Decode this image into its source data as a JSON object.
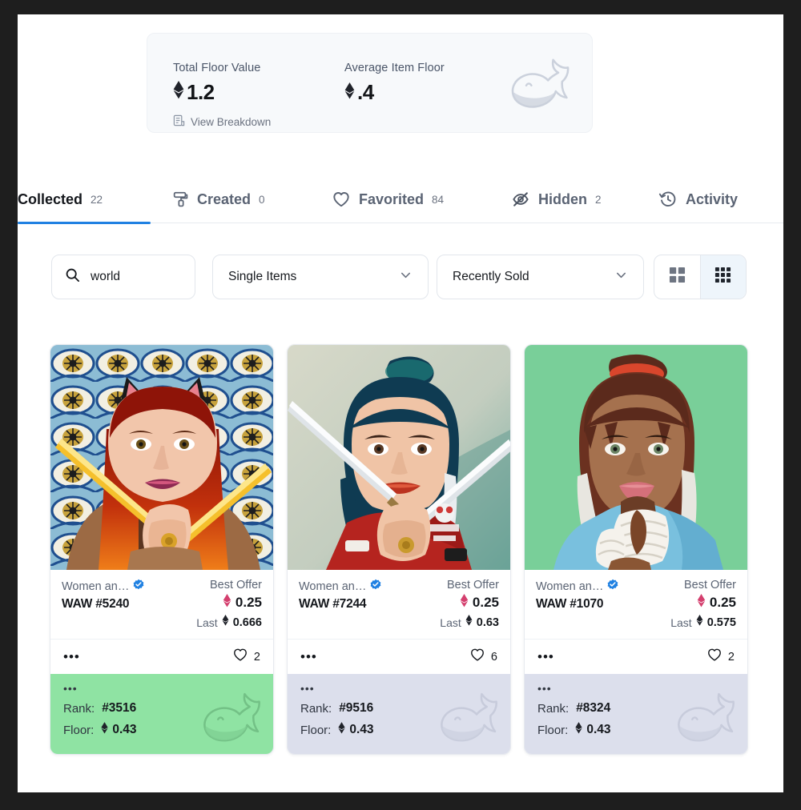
{
  "stats": {
    "total_floor_label": "Total Floor Value",
    "total_floor_value": "1.2",
    "avg_floor_label": "Average Item Floor",
    "avg_floor_value": ".4",
    "breakdown_link": "View Breakdown",
    "eth_symbol": "♦",
    "card_bg": "#f7f9fb"
  },
  "tabs": [
    {
      "label": "Collected",
      "count": "22",
      "icon": "none",
      "active": true
    },
    {
      "label": "Created",
      "count": "0",
      "icon": "paint-roller-icon",
      "active": false
    },
    {
      "label": "Favorited",
      "count": "84",
      "icon": "heart-icon",
      "active": false
    },
    {
      "label": "Hidden",
      "count": "2",
      "icon": "eye-off-icon",
      "active": false
    },
    {
      "label": "Activity",
      "count": "",
      "icon": "history-icon",
      "active": false
    }
  ],
  "accent_color": "#2081e2",
  "filters": {
    "search_value": "world",
    "search_placeholder": "Search",
    "dropdown_items": "Single Items",
    "dropdown_sort": "Recently Sold",
    "view_grid_large": "grid-2x2-icon",
    "view_grid_small": "grid-3x3-icon",
    "active_view": "grid-3x3-icon"
  },
  "cards": [
    {
      "collection": "Women an…",
      "verified": true,
      "name": "WAW #5240",
      "offer_label": "Best Offer",
      "offer_price": "0.25",
      "last_label": "Last",
      "last_price": "0.666",
      "likes": "2",
      "menu": "•••",
      "rank_label": "Rank:",
      "rank_value": "#3516",
      "floor_label": "Floor:",
      "floor_value": "0.43",
      "footer_color": "#8fe3a3",
      "art": "woman-red-hair-cat-ears-gold-swords"
    },
    {
      "collection": "Women an…",
      "verified": true,
      "name": "WAW #7244",
      "offer_label": "Best Offer",
      "offer_price": "0.25",
      "last_label": "Last",
      "last_price": "0.63",
      "likes": "6",
      "menu": "•••",
      "rank_label": "Rank:",
      "rank_value": "#9516",
      "floor_label": "Floor:",
      "floor_value": "0.43",
      "footer_color": "#dcdfec",
      "art": "woman-blue-hair-red-shirt-silver-blades"
    },
    {
      "collection": "Women an…",
      "verified": true,
      "name": "WAW #1070",
      "offer_label": "Best Offer",
      "offer_price": "0.25",
      "last_label": "Last",
      "last_price": "0.575",
      "likes": "2",
      "menu": "•••",
      "rank_label": "Rank:",
      "rank_value": "#8324",
      "floor_label": "Floor:",
      "floor_value": "0.43",
      "footer_color": "#dcdfec",
      "art": "woman-brown-bun-bandaged-hands-blue-top"
    }
  ]
}
